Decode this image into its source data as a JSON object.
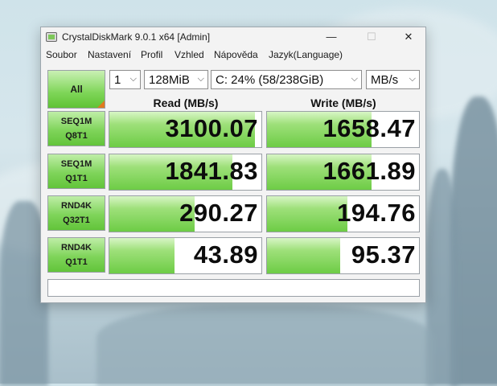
{
  "window": {
    "title": "CrystalDiskMark 9.0.1 x64 [Admin]",
    "minimize_glyph": "—",
    "maximize_glyph": "☐",
    "close_glyph": "✕"
  },
  "menu": [
    "Soubor",
    "Nastavení",
    "Profil",
    "Vzhled",
    "Nápověda",
    "Jazyk(Language)"
  ],
  "controls": {
    "all_label": "All",
    "count": "1",
    "size": "128MiB",
    "drive": "C: 24% (58/238GiB)",
    "unit": "MB/s",
    "chevron_glyph": "⌵"
  },
  "columns": {
    "read": "Read (MB/s)",
    "write": "Write (MB/s)"
  },
  "tests": [
    {
      "line1": "SEQ1M",
      "line2": "Q8T1",
      "read": "3100.07",
      "write": "1658.47",
      "read_fill": 0.96,
      "write_fill": 0.69
    },
    {
      "line1": "SEQ1M",
      "line2": "Q1T1",
      "read": "1841.83",
      "write": "1661.89",
      "read_fill": 0.81,
      "write_fill": 0.69
    },
    {
      "line1": "RND4K",
      "line2": "Q32T1",
      "read": "290.27",
      "write": "194.76",
      "read_fill": 0.56,
      "write_fill": 0.53
    },
    {
      "line1": "RND4K",
      "line2": "Q1T1",
      "read": "43.89",
      "write": "95.37",
      "read_fill": 0.43,
      "write_fill": 0.48
    }
  ],
  "status_text": ""
}
